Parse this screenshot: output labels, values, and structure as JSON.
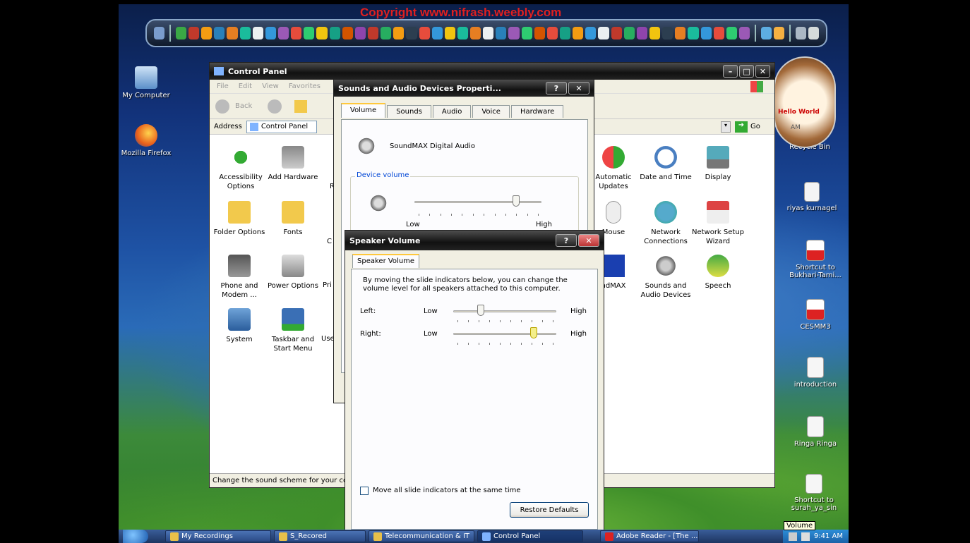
{
  "overlay": {
    "copyright": "Copyright www.nifrash.weebly.com"
  },
  "desktop_icons": [
    {
      "label": "My Computer"
    },
    {
      "label": "Mozilla Firefox"
    },
    {
      "label": "Recycle Bin"
    },
    {
      "label": "riyas kurnagel"
    },
    {
      "label": "Shortcut to Bukhari-Tami..."
    },
    {
      "label": "CESMM3"
    },
    {
      "label": "introduction"
    },
    {
      "label": "Ringa Ringa"
    },
    {
      "label": "Shortcut to surah_ya_sin"
    }
  ],
  "clock_gadget": {
    "text": "Hello World",
    "ampm": "AM"
  },
  "control_panel": {
    "title": "Control Panel",
    "menu": [
      "File",
      "Edit",
      "View",
      "Favorites"
    ],
    "back_label": "Back",
    "address_label": "Address",
    "address_value": "Control Panel",
    "go_label": "Go",
    "status_text": "Change the sound scheme for your co",
    "items": [
      {
        "label": "Accessibility Options"
      },
      {
        "label": "Add Hardware"
      },
      {
        "label": "Folder Options"
      },
      {
        "label": "Fonts"
      },
      {
        "label": "Phone and Modem ..."
      },
      {
        "label": "Power Options"
      },
      {
        "label": "System"
      },
      {
        "label": "Taskbar and Start Menu"
      },
      {
        "label": "Automatic Updates"
      },
      {
        "label": "Date and Time"
      },
      {
        "label": "Display"
      },
      {
        "label": "Mouse"
      },
      {
        "label": "Network Connections"
      },
      {
        "label": "Network Setup Wizard"
      },
      {
        "label": "ndMAX"
      },
      {
        "label": "Sounds and Audio Devices"
      },
      {
        "label": "Speech"
      }
    ],
    "clipped_letters": [
      "R",
      "C",
      "Pri",
      "Use"
    ]
  },
  "sounds_dialog": {
    "title": "Sounds and Audio Devices Properti...",
    "tabs": [
      "Volume",
      "Sounds",
      "Audio",
      "Voice",
      "Hardware"
    ],
    "device_name": "SoundMAX Digital Audio",
    "device_volume_label": "Device volume",
    "low_label": "Low",
    "high_label": "High",
    "device_volume_level": 0.8
  },
  "speaker_dialog": {
    "title": "Speaker Volume",
    "tab": "Speaker Volume",
    "description": "By moving the slide indicators below, you can change the volume level for all speakers attached to this computer.",
    "left_label": "Left:",
    "right_label": "Right:",
    "low_label": "Low",
    "high_label": "High",
    "left_level": 0.27,
    "right_level": 0.78,
    "move_all_label": "Move all slide indicators at the same time",
    "restore_label": "Restore Defaults"
  },
  "taskbar": {
    "buttons": [
      "My Recordings",
      "S_Recored",
      "Telecommunication & IT",
      "Control Panel",
      "Adobe Reader - [The ..."
    ],
    "time": "9:41 AM",
    "tooltip": "Volume"
  },
  "colors": {
    "title_bar": "#1a1a1a",
    "copyright": "#e02020",
    "highlight": "#ffc83c"
  }
}
